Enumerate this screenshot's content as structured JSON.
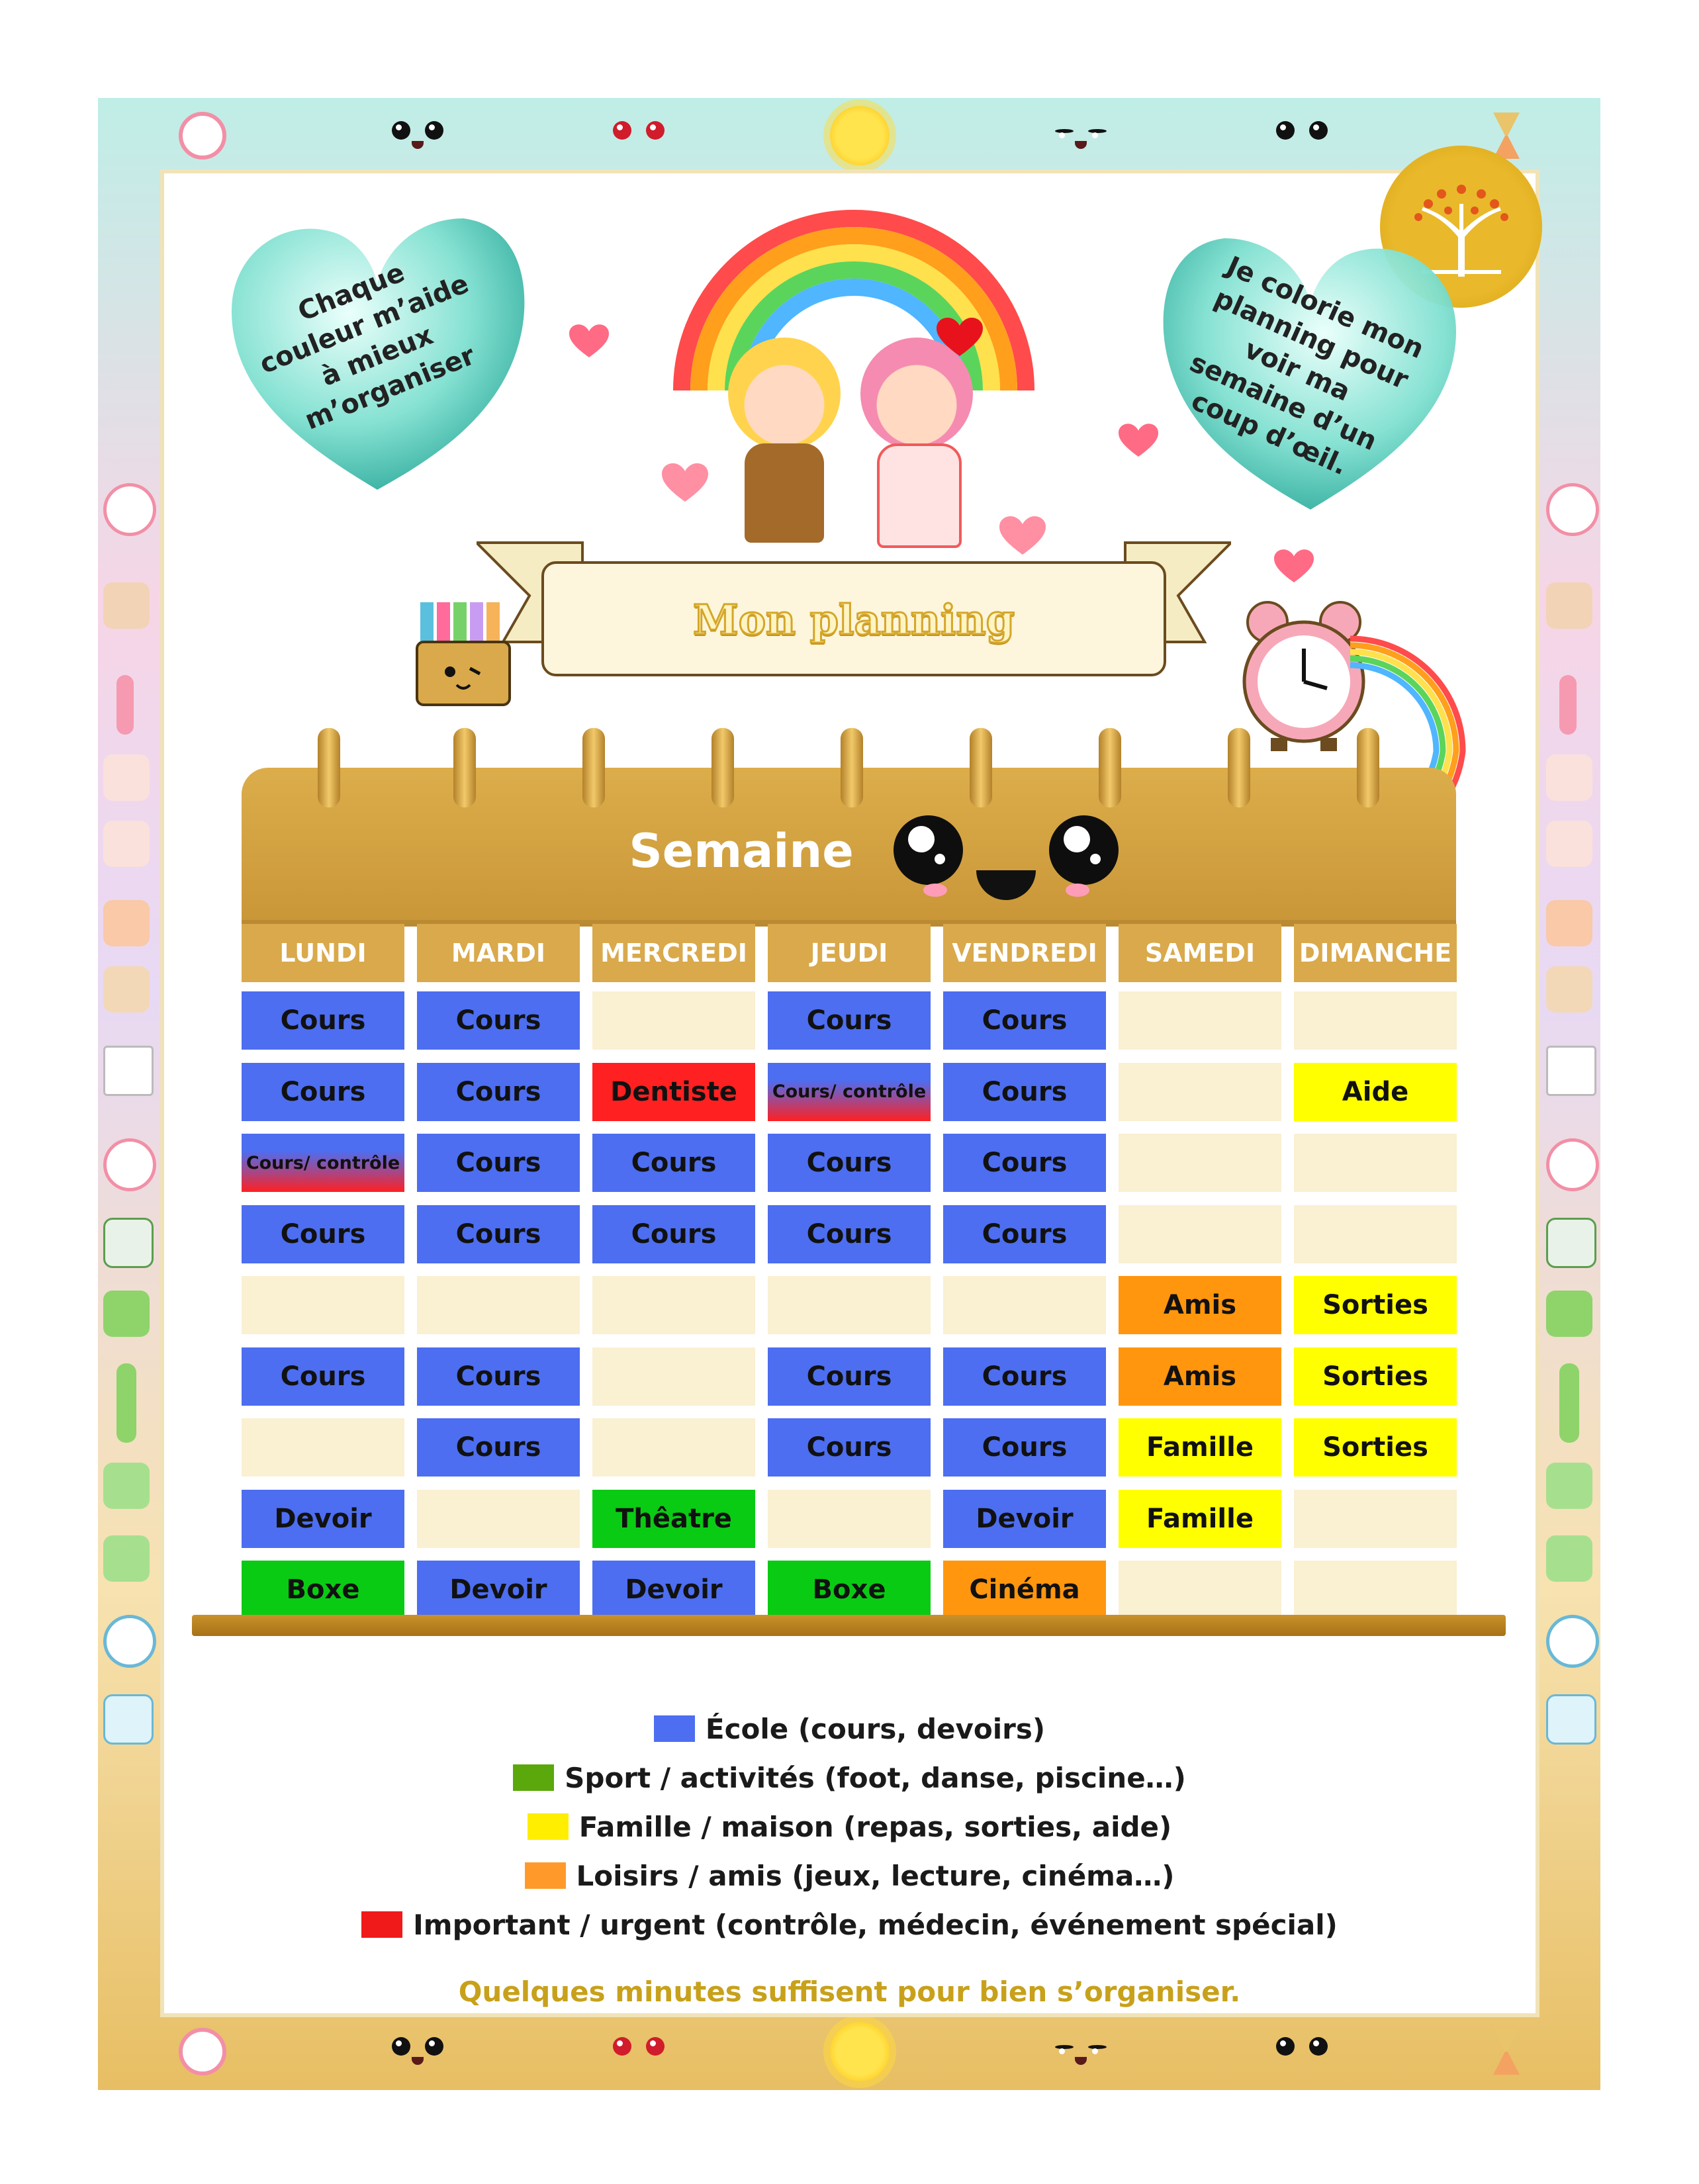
{
  "heart_left_text": "Chaque couleur m’aide à mieux m’organiser",
  "heart_right_text": "Je colorie mon planning pour voir ma semaine d’un coup d’œil.",
  "banner_title": "Mon planning",
  "calendar_title": "Semaine",
  "days": [
    "LUNDI",
    "MARDI",
    "MERCREDI",
    "JEUDI",
    "VENDREDI",
    "SAMEDI",
    "DIMANCHE"
  ],
  "colors": {
    "school": "#4d6ef0",
    "sport": "#0acb13",
    "family": "#ffff00",
    "leisure": "#ff960e",
    "important": "#ff2021",
    "empty": "#faf0d2",
    "header": "#d9a94b"
  },
  "grid": [
    [
      {
        "t": "Cours",
        "c": "school"
      },
      {
        "t": "Cours",
        "c": "school"
      },
      {
        "t": "",
        "c": "empty"
      },
      {
        "t": "Cours",
        "c": "school"
      },
      {
        "t": "Cours",
        "c": "school"
      },
      {
        "t": "",
        "c": "empty"
      },
      {
        "t": "",
        "c": "empty"
      }
    ],
    [
      {
        "t": "Cours",
        "c": "school"
      },
      {
        "t": "Cours",
        "c": "school"
      },
      {
        "t": "Dentiste",
        "c": "important"
      },
      {
        "t": "Cours/ contrôle",
        "c": "mixed"
      },
      {
        "t": "Cours",
        "c": "school"
      },
      {
        "t": "",
        "c": "empty"
      },
      {
        "t": "Aide",
        "c": "family"
      }
    ],
    [
      {
        "t": "Cours/ contrôle",
        "c": "mixed"
      },
      {
        "t": "Cours",
        "c": "school"
      },
      {
        "t": "Cours",
        "c": "school"
      },
      {
        "t": "Cours",
        "c": "school"
      },
      {
        "t": "Cours",
        "c": "school"
      },
      {
        "t": "",
        "c": "empty"
      },
      {
        "t": "",
        "c": "empty"
      }
    ],
    [
      {
        "t": "Cours",
        "c": "school"
      },
      {
        "t": "Cours",
        "c": "school"
      },
      {
        "t": "Cours",
        "c": "school"
      },
      {
        "t": "Cours",
        "c": "school"
      },
      {
        "t": "Cours",
        "c": "school"
      },
      {
        "t": "",
        "c": "empty"
      },
      {
        "t": "",
        "c": "empty"
      }
    ],
    [
      {
        "t": "",
        "c": "empty"
      },
      {
        "t": "",
        "c": "empty"
      },
      {
        "t": "",
        "c": "empty"
      },
      {
        "t": "",
        "c": "empty"
      },
      {
        "t": "",
        "c": "empty"
      },
      {
        "t": "Amis",
        "c": "leisure"
      },
      {
        "t": "Sorties",
        "c": "family"
      }
    ],
    [
      {
        "t": "Cours",
        "c": "school"
      },
      {
        "t": "Cours",
        "c": "school"
      },
      {
        "t": "",
        "c": "empty"
      },
      {
        "t": "Cours",
        "c": "school"
      },
      {
        "t": "Cours",
        "c": "school"
      },
      {
        "t": "Amis",
        "c": "leisure"
      },
      {
        "t": "Sorties",
        "c": "family"
      }
    ],
    [
      {
        "t": "",
        "c": "empty"
      },
      {
        "t": "Cours",
        "c": "school"
      },
      {
        "t": "",
        "c": "empty"
      },
      {
        "t": "Cours",
        "c": "school"
      },
      {
        "t": "Cours",
        "c": "school"
      },
      {
        "t": "Famille",
        "c": "family"
      },
      {
        "t": "Sorties",
        "c": "family"
      }
    ],
    [
      {
        "t": "Devoir",
        "c": "school"
      },
      {
        "t": "",
        "c": "empty"
      },
      {
        "t": "Thêatre",
        "c": "sport"
      },
      {
        "t": "",
        "c": "empty"
      },
      {
        "t": "Devoir",
        "c": "school"
      },
      {
        "t": "Famille",
        "c": "family"
      },
      {
        "t": "",
        "c": "empty"
      }
    ],
    [
      {
        "t": "Boxe",
        "c": "sport"
      },
      {
        "t": "Devoir",
        "c": "school"
      },
      {
        "t": "Devoir",
        "c": "school"
      },
      {
        "t": "Boxe",
        "c": "sport"
      },
      {
        "t": "Cinéma",
        "c": "leisure"
      },
      {
        "t": "",
        "c": "empty"
      },
      {
        "t": "",
        "c": "empty"
      }
    ]
  ],
  "legend": [
    {
      "label": "École (cours, devoirs)",
      "color": "#4d6ef0"
    },
    {
      "label": "Sport / activités (foot, danse, piscine…)",
      "color": "#5aa80c"
    },
    {
      "label": "Famille / maison (repas, sorties, aide)",
      "color": "#ffee00"
    },
    {
      "label": "Loisirs / amis (jeux, lecture, cinéma…)",
      "color": "#ff9a2a"
    },
    {
      "label": "Important / urgent (contrôle, médecin, événement spécial)",
      "color": "#f01a1a"
    }
  ],
  "tagline": "Quelques minutes suffisent pour bien s’organiser."
}
